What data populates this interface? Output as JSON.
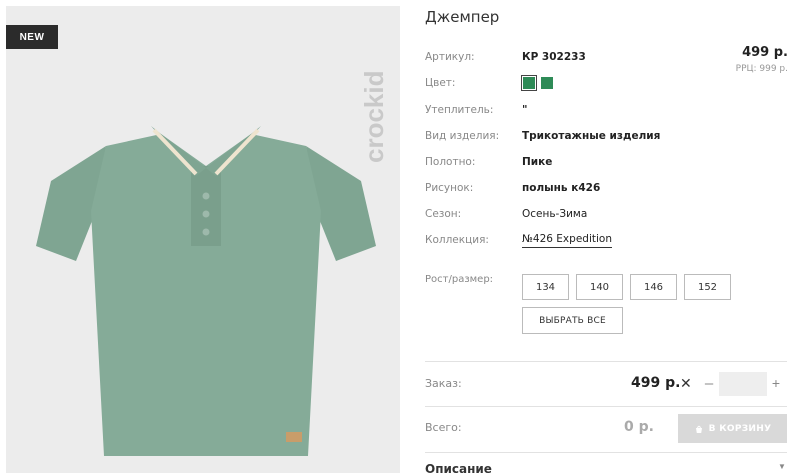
{
  "badge": "NEW",
  "brand": "crockid",
  "product": {
    "title": "Джемпер",
    "price": "499 р.",
    "rrp": "РРЦ: 999 р."
  },
  "attributes": [
    {
      "label": "Артикул:",
      "value": "КР 302233"
    },
    {
      "label": "Цвет:",
      "value": ""
    },
    {
      "label": "Утеплитель:",
      "value": "\""
    },
    {
      "label": "Вид изделия:",
      "value": "Трикотажные изделия"
    },
    {
      "label": "Полотно:",
      "value": "Пике"
    },
    {
      "label": "Рисунок:",
      "value": "полынь к426"
    },
    {
      "label": "Сезон:",
      "value": "Осень-Зима"
    },
    {
      "label": "Коллекция:",
      "value": "№426 Expedition"
    }
  ],
  "colors": {
    "swatch": "#2e8b57"
  },
  "sizes": {
    "label": "Рост/размер:",
    "options": [
      "134",
      "140",
      "146",
      "152"
    ],
    "select_all": "ВЫБРАТЬ ВСЕ"
  },
  "order": {
    "label": "Заказ:",
    "price": "499 р.",
    "times": "✕",
    "minus": "–",
    "plus": "+",
    "quantity": ""
  },
  "total": {
    "label": "Всего:",
    "value": "0 р.",
    "cart_button": "В КОРЗИНУ"
  },
  "description": {
    "label": "Описание",
    "icon": "chevron-down-icon"
  }
}
